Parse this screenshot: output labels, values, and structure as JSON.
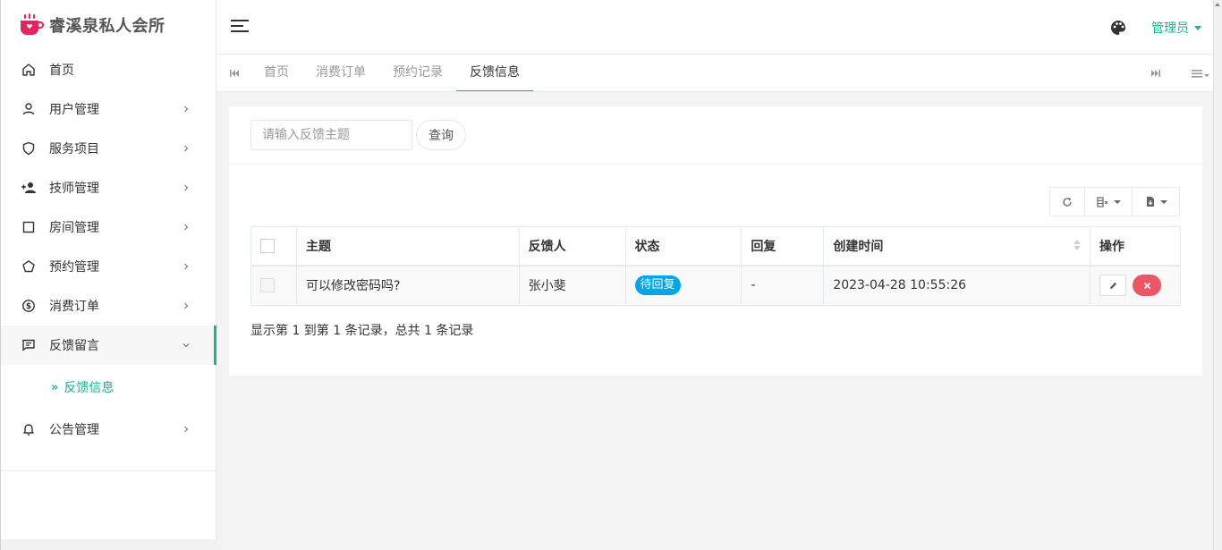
{
  "app": {
    "title": "睿溪泉私人会所"
  },
  "header": {
    "admin_label": "管理员"
  },
  "sidebar": {
    "items": [
      {
        "label": "首页",
        "icon": "home-icon"
      },
      {
        "label": "用户管理",
        "icon": "user-icon"
      },
      {
        "label": "服务项目",
        "icon": "shield-icon"
      },
      {
        "label": "技师管理",
        "icon": "user-plus-icon"
      },
      {
        "label": "房间管理",
        "icon": "square-icon"
      },
      {
        "label": "预约管理",
        "icon": "pentagon-icon"
      },
      {
        "label": "消费订单",
        "icon": "dollar-circle-icon"
      },
      {
        "label": "反馈留言",
        "icon": "message-icon"
      },
      {
        "label": "公告管理",
        "icon": "bell-icon"
      }
    ],
    "submenu_active": {
      "arrow": "»",
      "label": "反馈信息"
    }
  },
  "tabs": [
    {
      "label": "首页"
    },
    {
      "label": "消费订单"
    },
    {
      "label": "预约记录"
    },
    {
      "label": "反馈信息"
    }
  ],
  "search": {
    "placeholder": "请输入反馈主题",
    "button_label": "查询"
  },
  "table": {
    "columns": [
      "主题",
      "反馈人",
      "状态",
      "回复",
      "创建时间",
      "操作"
    ],
    "rows": [
      {
        "subject": "可以修改密码吗?",
        "author": "张小斐",
        "status": "待回复",
        "reply": "-",
        "created": "2023-04-28 10:55:26"
      }
    ]
  },
  "pagination": {
    "info": "显示第 1 到第 1 条记录，总共 1 条记录"
  },
  "colors": {
    "accent": "#1ab394",
    "badge": "#00a7e6",
    "danger": "#ed5565",
    "logo": "#e6245e"
  }
}
